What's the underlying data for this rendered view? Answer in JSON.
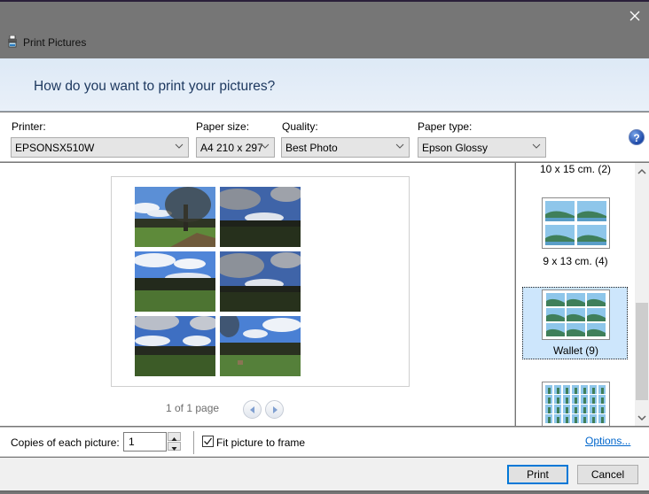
{
  "window": {
    "title": "Print Pictures",
    "icons": {
      "app": "printer-icon",
      "close": "close-icon"
    }
  },
  "header": {
    "question": "How do you want to print your pictures?"
  },
  "options": {
    "printer": {
      "label": "Printer:",
      "value": "EPSONSX510W"
    },
    "paper_size": {
      "label": "Paper size:",
      "value": "A4 210 x 297"
    },
    "quality": {
      "label": "Quality:",
      "value": "Best Photo"
    },
    "paper_type": {
      "label": "Paper type:",
      "value": "Epson Glossy"
    },
    "help_glyph": "?",
    "colors": {
      "select_bg": "#e5e5e5",
      "header_text": "#1e3960"
    }
  },
  "preview": {
    "photos": [
      {
        "name": "photo-tree-field"
      },
      {
        "name": "photo-clouds-dark-field"
      },
      {
        "name": "photo-clouds-treeline"
      },
      {
        "name": "photo-clouds-dark-field-2"
      },
      {
        "name": "photo-trees-clouds"
      },
      {
        "name": "photo-field-bench"
      }
    ],
    "pager_text": "1 of 1 page"
  },
  "layouts": {
    "items": [
      {
        "label": "10 x 15 cm. (2)",
        "selected": false
      },
      {
        "label": "9 x 13 cm. (4)",
        "selected": false
      },
      {
        "label": "Wallet (9)",
        "selected": true
      },
      {
        "label": "",
        "selected": false
      }
    ],
    "scroll_position_fraction": 0.62
  },
  "copies": {
    "label": "Copies of each picture:",
    "value": "1",
    "fit_label": "Fit picture to frame",
    "fit_checked": true,
    "options_link": "Options..."
  },
  "footer": {
    "print_label": "Print",
    "cancel_label": "Cancel",
    "accent_color": "#0078d7"
  }
}
